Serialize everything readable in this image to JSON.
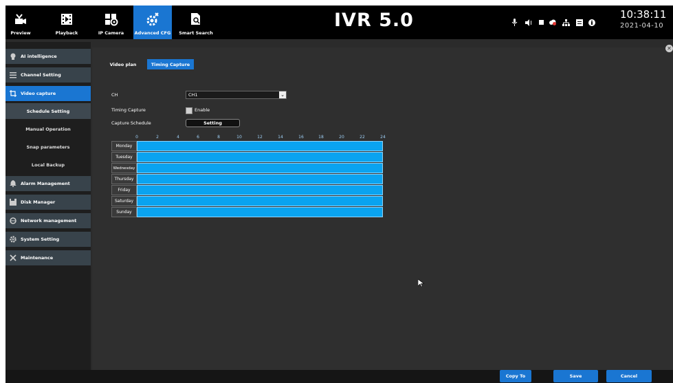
{
  "topbar": {
    "nav": [
      {
        "label": "Preview",
        "icon": "camera-preview-icon"
      },
      {
        "label": "Playback",
        "icon": "playback-icon"
      },
      {
        "label": "IP Camera",
        "icon": "ip-camera-icon"
      },
      {
        "label": "Advanced CFG",
        "icon": "advanced-cfg-gear-icon",
        "active": true
      },
      {
        "label": "Smart Search",
        "icon": "smart-search-icon"
      }
    ],
    "app_title": "IVR 5.0",
    "status_icons": [
      "microphone-icon",
      "volume-icon",
      "record-icon",
      "cloud-icon",
      "network-icon",
      "storage-icon",
      "info-icon"
    ],
    "clock_time": "10:38:11",
    "clock_date": "2021-04-10"
  },
  "sidebar": {
    "items": [
      {
        "label": "AI intelligence",
        "icon": "ai-icon"
      },
      {
        "label": "Channel Setting",
        "icon": "channel-list-icon"
      },
      {
        "label": "Video capture",
        "icon": "crop-icon",
        "active": true
      },
      {
        "label": "Alarm Management",
        "icon": "bell-icon"
      },
      {
        "label": "Disk Manager",
        "icon": "disk-icon"
      },
      {
        "label": "Network management",
        "icon": "network-globe-icon"
      },
      {
        "label": "System Setting",
        "icon": "gear-icon"
      },
      {
        "label": "Maintenance",
        "icon": "tools-icon"
      }
    ],
    "subitems": [
      {
        "label": "Schedule Setting",
        "active": true
      },
      {
        "label": "Manual Operation"
      },
      {
        "label": "Snap parameters"
      },
      {
        "label": "Local Backup"
      }
    ]
  },
  "main": {
    "tabs": [
      {
        "label": "Video plan"
      },
      {
        "label": "Timing Capture",
        "active": true
      }
    ],
    "ch_label": "CH",
    "ch_value": "CH1",
    "timing_capture_label": "Timing Capture",
    "enable_label": "Enable",
    "enable_checked": false,
    "capture_schedule_label": "Capture Schedule",
    "setting_button": "Setting",
    "schedule": {
      "hours": [
        "0",
        "2",
        "4",
        "6",
        "8",
        "10",
        "12",
        "14",
        "16",
        "18",
        "20",
        "22",
        "24"
      ],
      "days": [
        "Monday",
        "Tuesday",
        "Wednesday",
        "Thursday",
        "Friday",
        "Saturday",
        "Sunday"
      ],
      "fill_color": "#0aa3f0",
      "coverage": "00:00-24:00 all days"
    }
  },
  "footer": {
    "copy_to": "Copy To",
    "save": "Save",
    "cancel": "Cancel"
  },
  "colors": {
    "accent": "#1a76d2",
    "schedule": "#0aa3f0",
    "sidebar_item": "#38434b",
    "background": "#2f2f2f"
  }
}
